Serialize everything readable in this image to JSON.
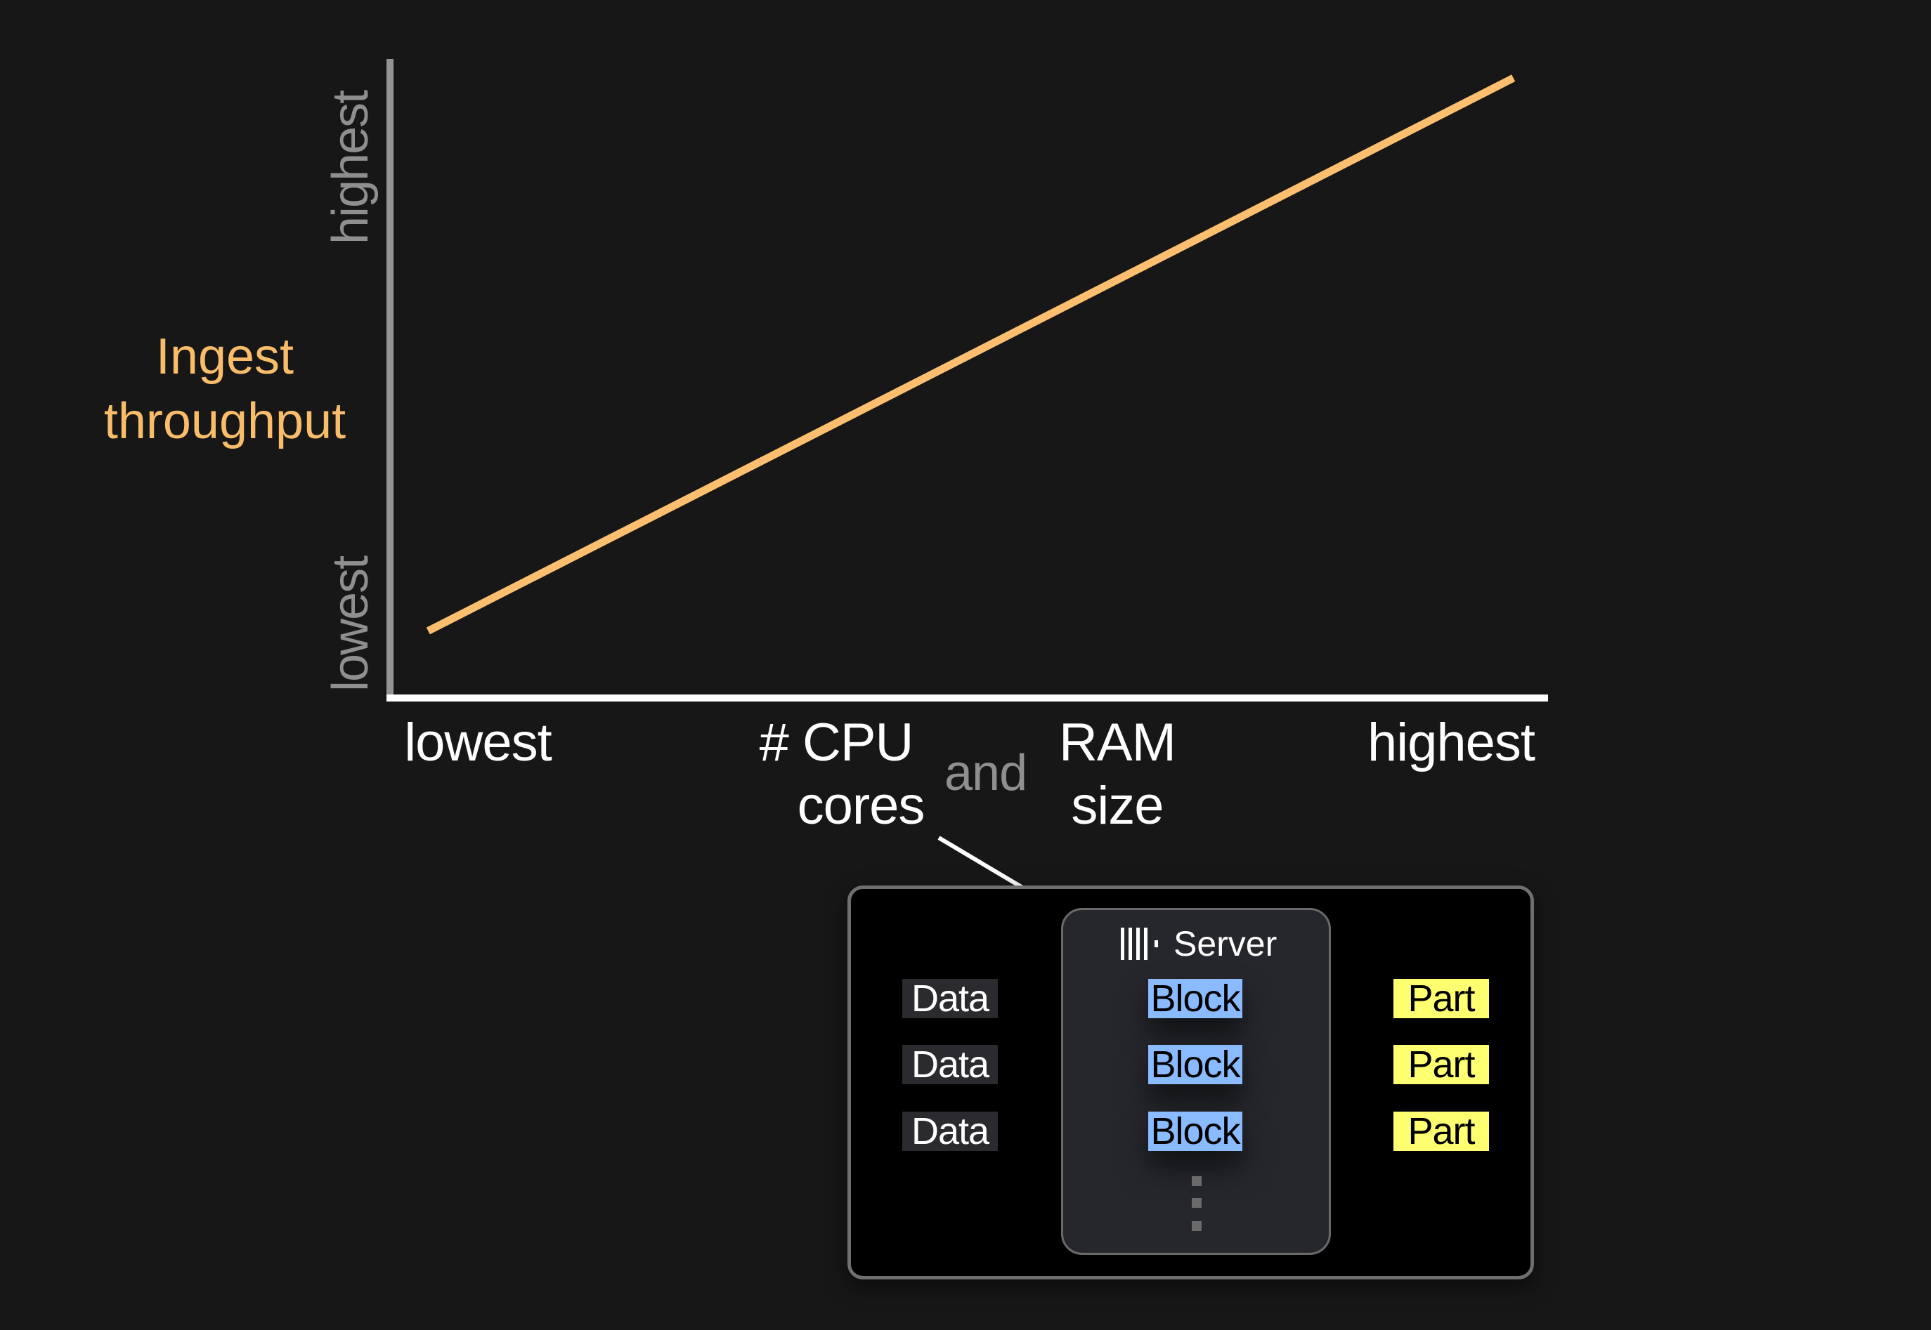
{
  "chart_data": {
    "type": "line",
    "title": "",
    "ylabel": "Ingest throughput",
    "xlabel": "# CPU cores and RAM size",
    "y_ticks": [
      "lowest",
      "highest"
    ],
    "x_ticks": [
      "lowest",
      "highest"
    ],
    "xlim": [
      0,
      1
    ],
    "ylim": [
      0,
      1
    ],
    "grid": false,
    "series": [
      {
        "name": "Ingest throughput",
        "color": "#fdbf6f",
        "x": [
          0.03,
          0.97
        ],
        "y": [
          0.1,
          0.97
        ]
      }
    ]
  },
  "axes": {
    "y_title_line1": "Ingest",
    "y_title_line2": "throughput",
    "y_high": "highest",
    "y_low": "lowest",
    "x_low": "lowest",
    "x_high": "highest",
    "x_cpu_line1": "# CPU",
    "x_cpu_line2": "cores",
    "x_and": "and",
    "x_ram_line1": "RAM",
    "x_ram_line2": "size"
  },
  "colors": {
    "line": "#fdbf6f",
    "title": "#f9bd6a",
    "block": "#8abaff",
    "part": "#ffff72",
    "data": "#2a2a2f"
  },
  "diagram": {
    "server_label": "Server",
    "server_icon": "clickhouse-logo-icon",
    "rows": [
      {
        "data": "Data",
        "block": "Block",
        "part": "Part"
      },
      {
        "data": "Data",
        "block": "Block",
        "part": "Part"
      },
      {
        "data": "Data",
        "block": "Block",
        "part": "Part"
      }
    ]
  }
}
